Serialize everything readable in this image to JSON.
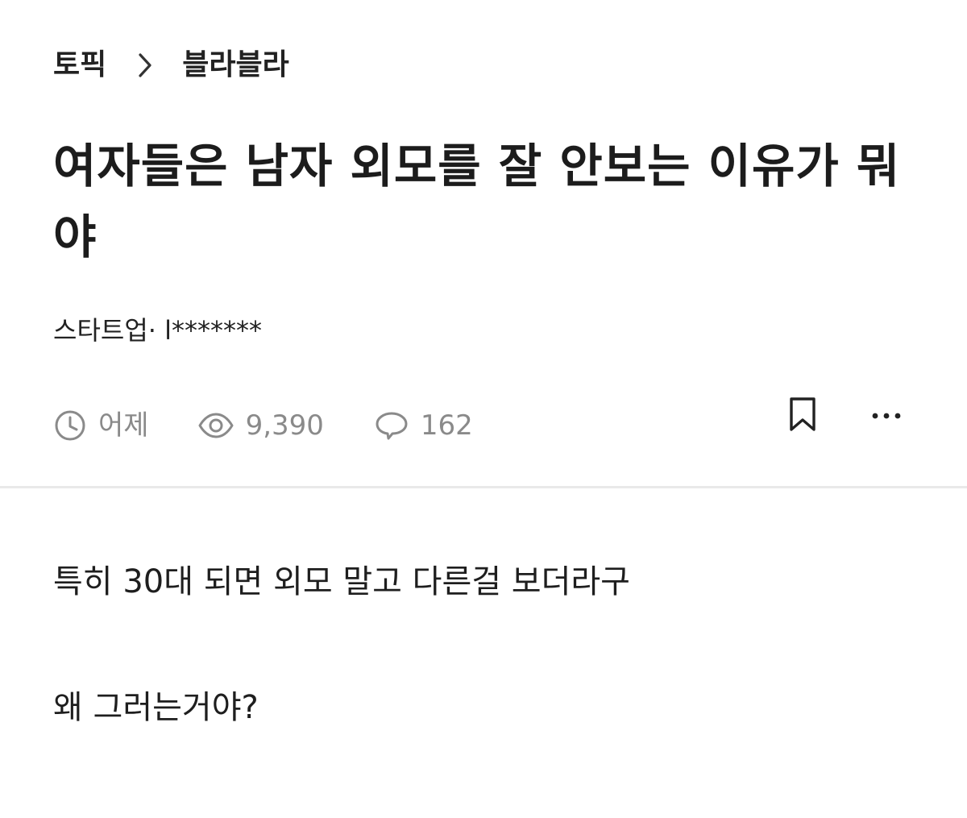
{
  "breadcrumb": {
    "category": "토픽",
    "board": "블라블라"
  },
  "post": {
    "title": "여자들은 남자 외모를 잘 안보는 이유가 뭐야",
    "author": "스타트업· l*******",
    "time": "어제",
    "views": "9,390",
    "comments": "162",
    "body": [
      "특히 30대 되면 외모 말고 다른걸 보더라구",
      "왜 그러는거야?"
    ]
  },
  "icons": {
    "separator": "chevron-right-icon",
    "time": "clock-icon",
    "views": "eye-icon",
    "comments": "speech-bubble-icon",
    "bookmark": "bookmark-icon",
    "more": "more-dots-icon"
  },
  "colors": {
    "text": "#1c1c1c",
    "meta": "#8a8a8a",
    "divider": "#e9e9e9"
  }
}
